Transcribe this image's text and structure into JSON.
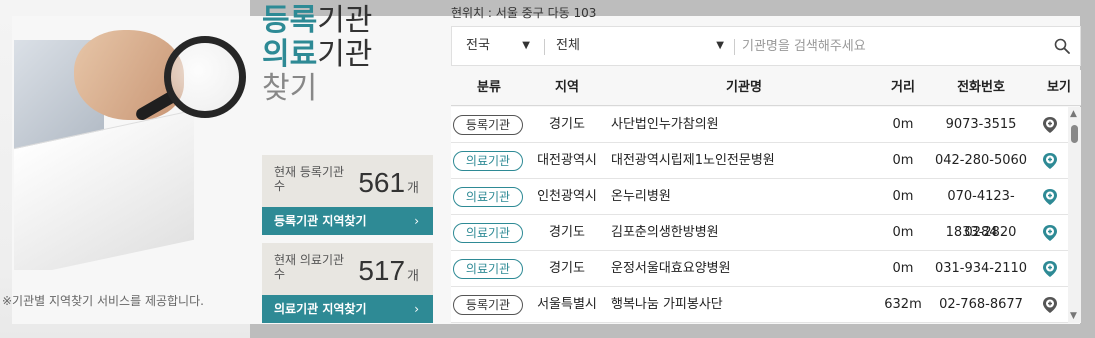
{
  "title": {
    "line1_strong": "등록",
    "line1_rest": "기관",
    "line2_strong": "의료",
    "line2_rest": "기관",
    "line3": "찾기"
  },
  "note": "※기관별 지역찾기 서비스를 제공합니다.",
  "stats": [
    {
      "label": "현재 등록기관수",
      "count": "561",
      "unit": "개",
      "button": "등록기관 지역찾기",
      "arrow": "›"
    },
    {
      "label": "현재 의료기관수",
      "count": "517",
      "unit": "개",
      "button": "의료기관 지역찾기",
      "arrow": "›"
    }
  ],
  "location": "현위치 : 서울 중구 다동 103",
  "search": {
    "region": "전국",
    "category": "전체",
    "placeholder": "기관명을 검색해주세요"
  },
  "table": {
    "headers": [
      "분류",
      "지역",
      "기관명",
      "거리",
      "전화번호",
      "보기"
    ],
    "rows": [
      {
        "type": "등록기관",
        "kind": "registered",
        "region": "경기도",
        "name": "사단법인누가참의원",
        "distance": "0m",
        "phone": "9073-3515",
        "pin_color": "#555555"
      },
      {
        "type": "의료기관",
        "kind": "medical",
        "region": "대전광역시",
        "name": "대전광역시립제1노인전문병원",
        "distance": "0m",
        "phone": "042-280-5060",
        "pin_color": "#2e8a95"
      },
      {
        "type": "의료기관",
        "kind": "medical",
        "region": "인천광역시",
        "name": "온누리병원",
        "distance": "0m",
        "phone": "070-4123-0284",
        "pin_color": "#2e8a95"
      },
      {
        "type": "의료기관",
        "kind": "medical",
        "region": "경기도",
        "name": "김포춘의생한방병원",
        "distance": "0m",
        "phone": "1833-2820",
        "pin_color": "#2e8a95"
      },
      {
        "type": "의료기관",
        "kind": "medical",
        "region": "경기도",
        "name": "운정서울대효요양병원",
        "distance": "0m",
        "phone": "031-934-2110",
        "pin_color": "#2e8a95"
      },
      {
        "type": "등록기관",
        "kind": "registered",
        "region": "서울특별시",
        "name": "행복나눔 가피봉사단",
        "distance": "632m",
        "phone": "02-768-8677",
        "pin_color": "#555555"
      }
    ]
  },
  "colors": {
    "accent": "#2e8a95",
    "registered": "#555555"
  },
  "icons": {
    "search": "search-icon",
    "map": "map-pin-plus-icon",
    "caret": "caret-down-icon"
  }
}
